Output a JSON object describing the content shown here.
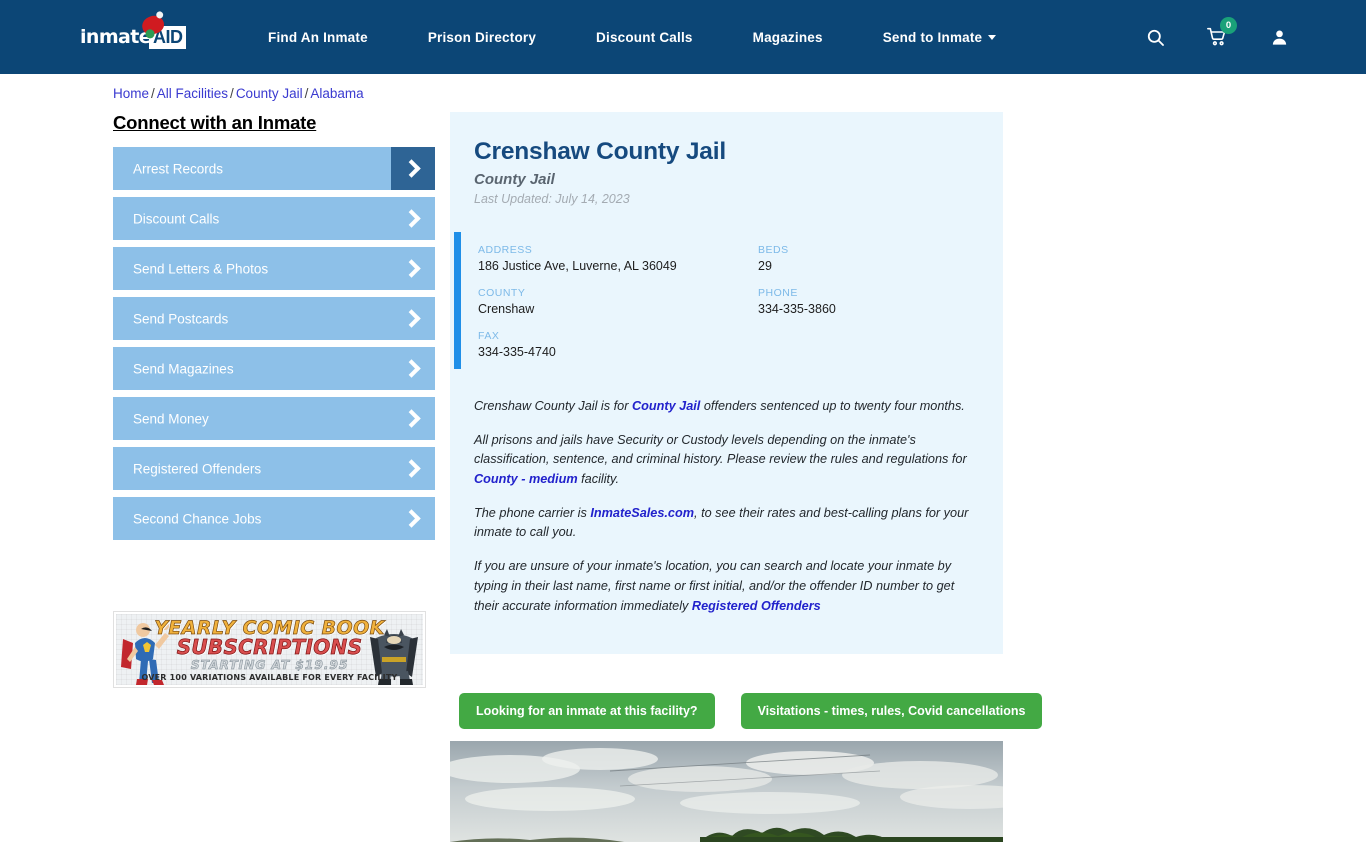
{
  "header": {
    "logo": {
      "word1": "inmate",
      "word2": "AID",
      "icon": "santa-hat-icon"
    },
    "nav": [
      {
        "label": "Find An Inmate",
        "has_caret": false
      },
      {
        "label": "Prison Directory",
        "has_caret": false
      },
      {
        "label": "Discount Calls",
        "has_caret": false
      },
      {
        "label": "Magazines",
        "has_caret": false
      },
      {
        "label": "Send to Inmate",
        "has_caret": true
      }
    ],
    "icons": {
      "search": "search-icon",
      "cart": "shopping-cart-icon",
      "cart_badge": "0",
      "account": "user-account-icon"
    },
    "bg_color": "#0c4676",
    "badge_color": "#1aa179"
  },
  "breadcrumb": {
    "items": [
      "Home",
      "All Facilities",
      "County Jail",
      "Alabama"
    ],
    "separator": "/"
  },
  "sidebar": {
    "title": "Connect with an Inmate",
    "items": [
      {
        "label": "Arrest Records"
      },
      {
        "label": "Discount Calls"
      },
      {
        "label": "Send Letters & Photos"
      },
      {
        "label": "Send Postcards"
      },
      {
        "label": "Send Magazines"
      },
      {
        "label": "Send Money"
      },
      {
        "label": "Registered Offenders"
      },
      {
        "label": "Second Chance Jobs"
      }
    ],
    "item_color": "#8dc0e8",
    "active_arrow_color": "#2e6495"
  },
  "ad": {
    "line1": "YEARLY COMIC BOOK",
    "line2": "SUBSCRIPTIONS",
    "line3": "STARTING AT $19.95",
    "line4": "OVER 100 VARIATIONS AVAILABLE FOR EVERY FACILITY",
    "left_character": "superman-figure",
    "right_character": "batman-figure"
  },
  "facility": {
    "name": "Crenshaw County Jail",
    "type": "County Jail",
    "last_updated": "Last Updated: July 14, 2023",
    "info": [
      {
        "label": "ADDRESS",
        "value": "186 Justice Ave, Luverne, AL 36049"
      },
      {
        "label": "BEDS",
        "value": "29"
      },
      {
        "label": "COUNTY",
        "value": "Crenshaw"
      },
      {
        "label": "PHONE",
        "value": "334-335-3860"
      },
      {
        "label": "FAX",
        "value": "334-335-4740"
      }
    ],
    "paragraphs": [
      {
        "parts": [
          {
            "text": "Crenshaw County Jail is for ",
            "link": false
          },
          {
            "text": "County Jail",
            "link": true
          },
          {
            "text": " offenders sentenced up to twenty four months.",
            "link": false
          }
        ]
      },
      {
        "parts": [
          {
            "text": "All prisons and jails have Security or Custody levels depending on the inmate's classification, sentence, and criminal history. Please review the rules and regulations for ",
            "link": false
          },
          {
            "text": "County - medium",
            "link": true
          },
          {
            "text": " facility.",
            "link": false
          }
        ]
      },
      {
        "parts": [
          {
            "text": "The phone carrier is ",
            "link": false
          },
          {
            "text": "InmateSales.com",
            "link": true
          },
          {
            "text": ", to see their rates and best-calling plans for your inmate to call you.",
            "link": false
          }
        ]
      },
      {
        "parts": [
          {
            "text": "If you are unsure of your inmate's location, you can search and locate your inmate by typing in their last name, first name or first initial, and/or the offender ID number to get their accurate information immediately ",
            "link": false
          },
          {
            "text": "Registered Offenders",
            "link": true
          }
        ]
      }
    ],
    "card_bg": "#eaf6fd",
    "accent_bar_color": "#1f8fe8"
  },
  "cta": {
    "buttons": [
      {
        "label": "Looking for an inmate at this facility?"
      },
      {
        "label": "Visitations - times, rules, Covid cancellations"
      }
    ],
    "color": "#43a944"
  },
  "photo": {
    "alt": "facility-exterior-photo-sky-and-treeline"
  }
}
